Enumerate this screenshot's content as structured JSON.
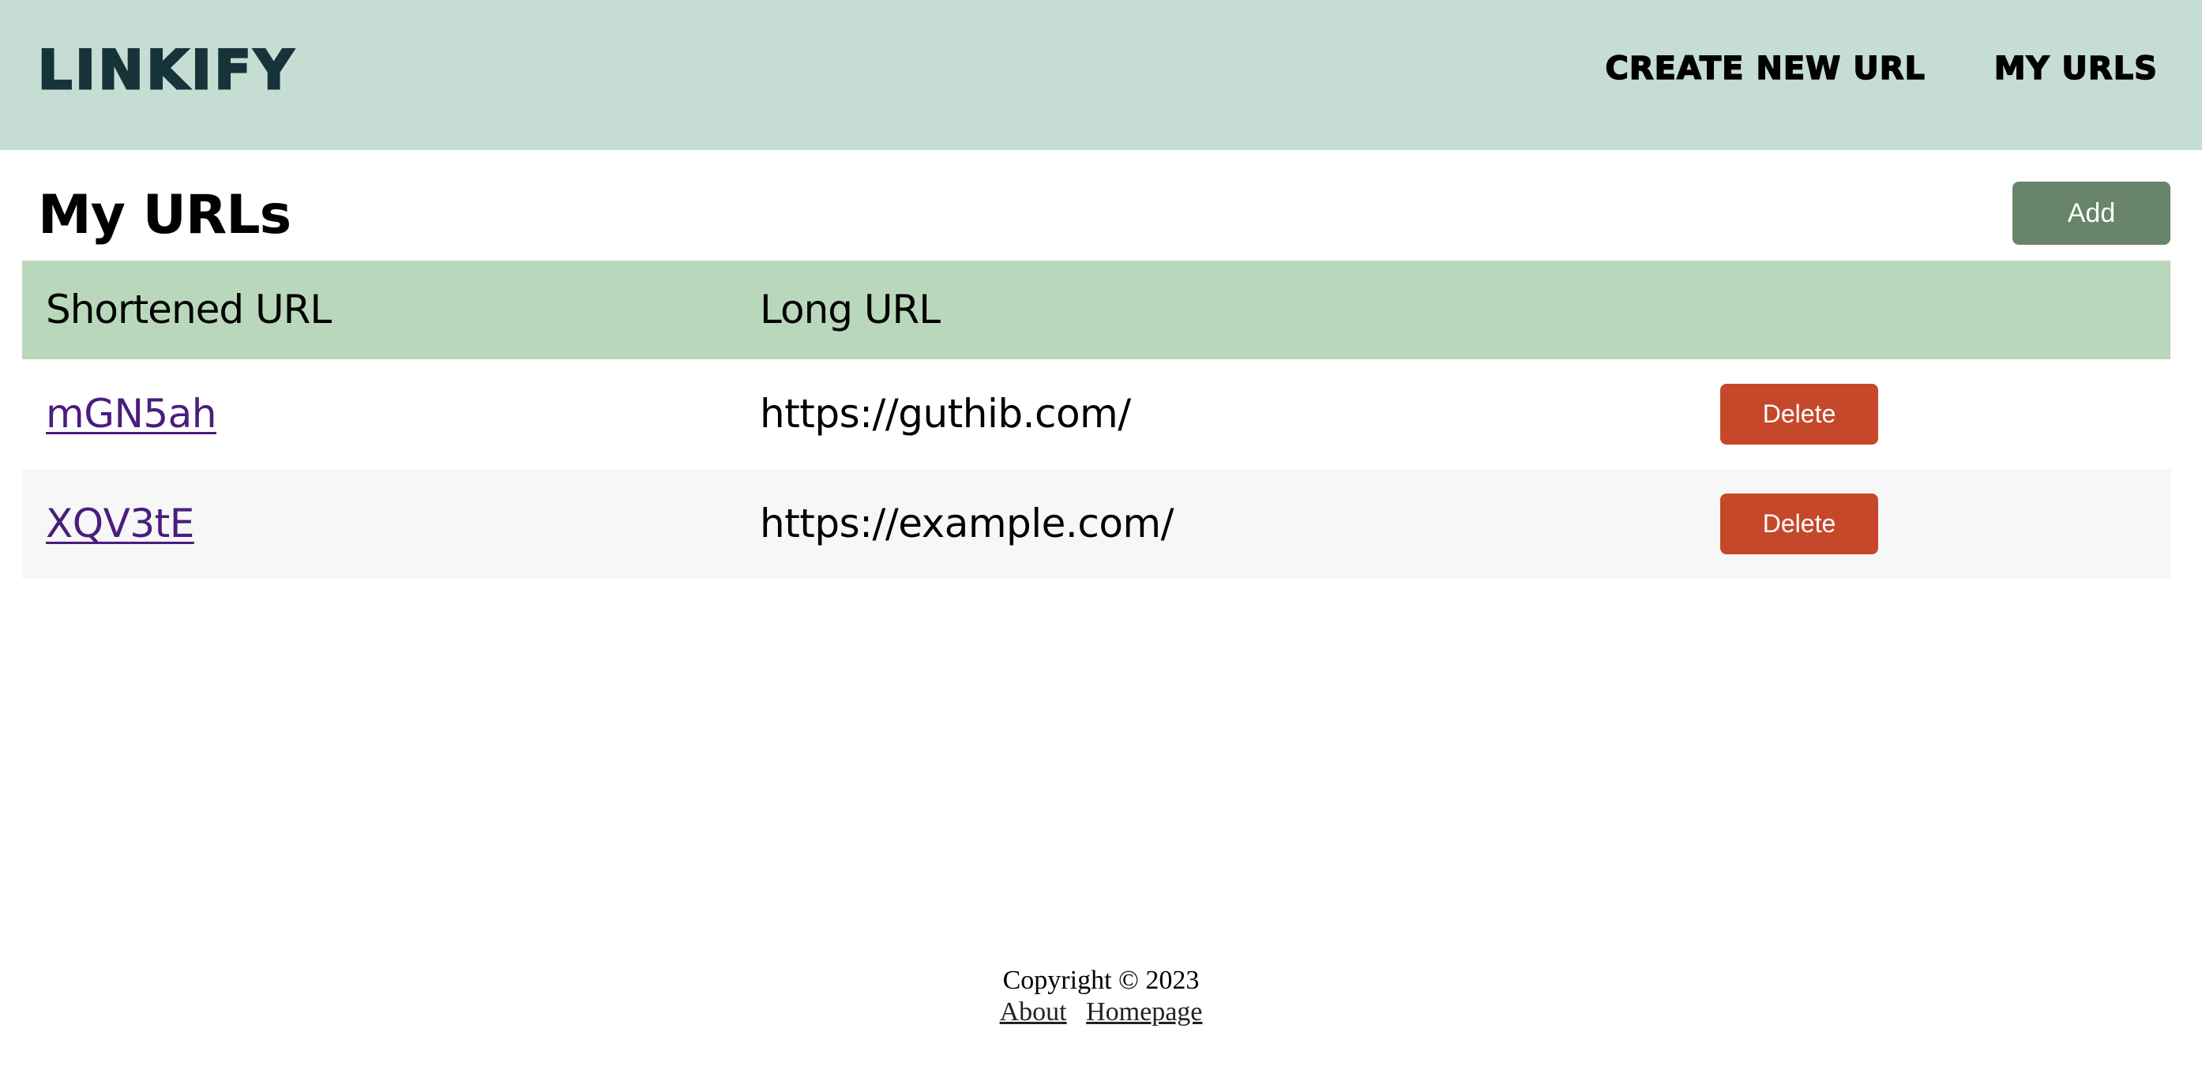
{
  "header": {
    "brand": "LINKIFY",
    "nav": {
      "create": "CREATE NEW URL",
      "my_urls": "MY URLS"
    }
  },
  "main": {
    "title": "My URLs",
    "add_label": "Add"
  },
  "table": {
    "columns": {
      "short": "Shortened URL",
      "long": "Long URL"
    },
    "rows": [
      {
        "short": "mGN5ah",
        "long": "https://guthib.com/",
        "delete_label": "Delete"
      },
      {
        "short": "XQV3tE",
        "long": "https://example.com/",
        "delete_label": "Delete"
      }
    ]
  },
  "footer": {
    "copyright": "Copyright © 2023",
    "links": {
      "about": "About",
      "homepage": "Homepage"
    }
  },
  "colors": {
    "header_bg": "#c6ddd3",
    "brand": "#16333a",
    "table_header_bg": "#b9d8bb",
    "add_button": "#688469",
    "delete_button": "#c6482b",
    "link": "#4a1d7e"
  }
}
